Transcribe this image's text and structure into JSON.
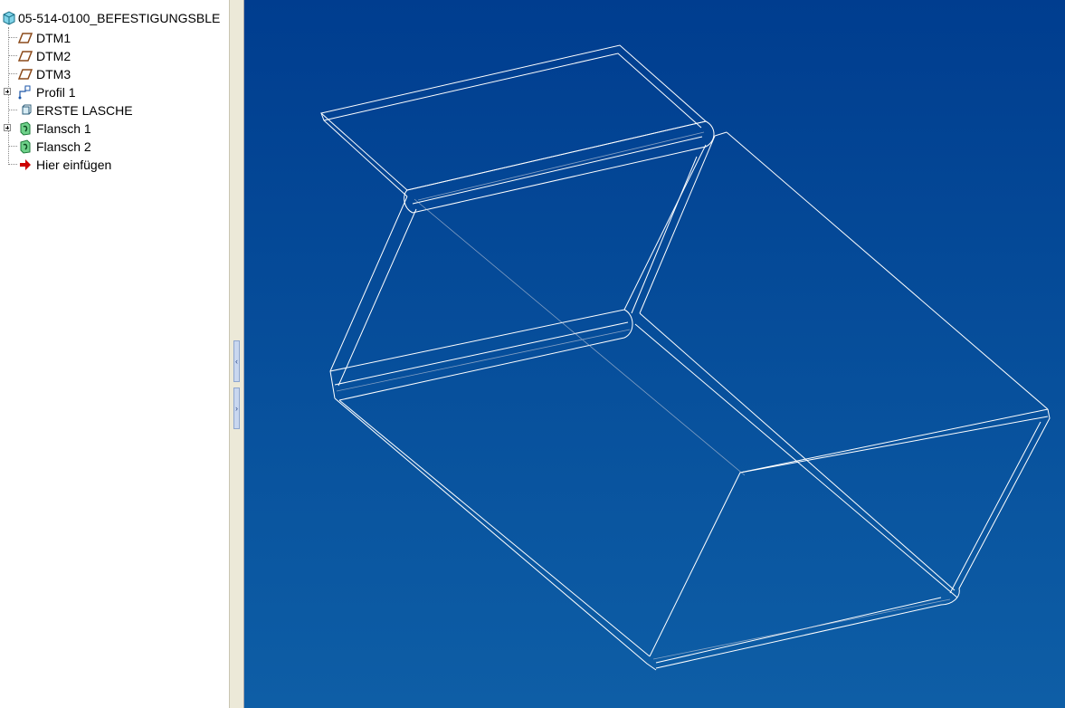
{
  "model_tree": {
    "root_label": "05-514-0100_BEFESTIGUNGSBLE",
    "items": [
      {
        "label": "DTM1",
        "icon": "datum-plane-icon",
        "expandable": false
      },
      {
        "label": "DTM2",
        "icon": "datum-plane-icon",
        "expandable": false
      },
      {
        "label": "DTM3",
        "icon": "datum-plane-icon",
        "expandable": false
      },
      {
        "label": "Profil 1",
        "icon": "sketch-icon",
        "expandable": true
      },
      {
        "label": "ERSTE LASCHE",
        "icon": "sheetmetal-wall-icon",
        "expandable": false
      },
      {
        "label": "Flansch 1",
        "icon": "flange-icon",
        "expandable": true
      },
      {
        "label": "Flansch 2",
        "icon": "flange-icon",
        "expandable": false
      },
      {
        "label": "Hier einfügen",
        "icon": "insert-here-arrow-icon",
        "expandable": false
      }
    ]
  },
  "splitter": {
    "collapse_icon": "‹",
    "expand_icon": "›"
  },
  "colors": {
    "viewport_top": "#003d8f",
    "viewport_bottom": "#0e5ea6",
    "wire_edge": "#ffffff",
    "hidden_edge": "#b9c3d6",
    "insert_arrow": "#cc0000",
    "datum_icon": "#8b4a1a",
    "flange_icon": "#2aa54a"
  }
}
